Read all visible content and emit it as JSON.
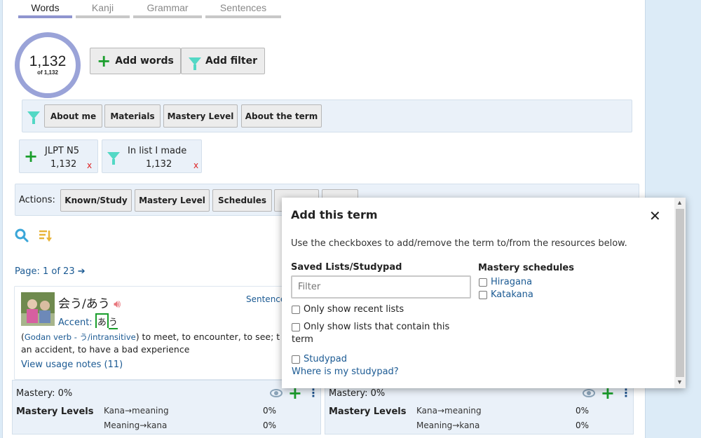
{
  "tabs": [
    "Words",
    "Kanji",
    "Grammar",
    "Sentences"
  ],
  "summary": {
    "count": "1,132",
    "of": "of 1,132"
  },
  "top_buttons": {
    "add_words": "Add words",
    "add_filter": "Add filter"
  },
  "filter_bar": [
    "About me",
    "Materials",
    "Mastery Level",
    "About the term"
  ],
  "chips": [
    {
      "label": "JLPT N5",
      "count": "1,132",
      "remove": "x"
    },
    {
      "label": "In list I made",
      "count": "1,132",
      "remove": "x"
    }
  ],
  "actions": {
    "label": "Actions:",
    "buttons": [
      "Known/Study",
      "Mastery Level",
      "Schedules"
    ]
  },
  "page_info": "Page: 1 of 23",
  "card": {
    "term": "会う/あう",
    "accent_label": "Accent:",
    "accent_kana_1": "あ",
    "accent_kana_2": "う",
    "sentence_link": "Sentence",
    "pos": "Godan verb - う/intransitive",
    "meaning_1": ") to meet, to encounter, to see; t",
    "meaning_2": "an accident, to have a bad experience",
    "usage_notes": "View usage notes (11)"
  },
  "mastery": {
    "title": "Mastery: 0%",
    "levels_label": "Mastery Levels",
    "row1": "Kana→meaning",
    "row2": "Meaning→kana",
    "pct1": "0%",
    "pct2": "0%"
  },
  "dialog": {
    "title": "Add this term",
    "close": "✕",
    "description": "Use the checkboxes to add/remove the term to/from the resources below.",
    "saved_heading": "Saved Lists/Studypad",
    "filter_placeholder": "Filter",
    "opt_recent": "Only show recent lists",
    "opt_contain_1": "Only show lists that contain this",
    "opt_contain_2": "term",
    "studypad": "Studypad",
    "where_link": "Where is my studypad?",
    "schedules_heading": "Mastery schedules",
    "schedules": [
      "Hiragana",
      "Katakana"
    ]
  },
  "colors": {
    "accent_green": "#1a9e2c",
    "link_blue": "#1b5a93",
    "ring": "#9aa3d8"
  }
}
